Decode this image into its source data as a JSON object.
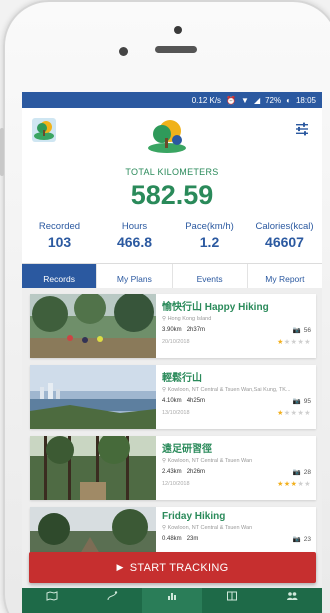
{
  "status_bar": {
    "speed": "0.12 K/s",
    "battery": "72%",
    "time": "18:05"
  },
  "header": {
    "total_label": "TOTAL KILOMETERS",
    "total_value": "582.59"
  },
  "stats": [
    {
      "label": "Recorded",
      "value": "103"
    },
    {
      "label": "Hours",
      "value": "466.8"
    },
    {
      "label": "Pace(km/h)",
      "value": "1.2"
    },
    {
      "label": "Calories(kcal)",
      "value": "46607"
    }
  ],
  "tabs": [
    "Records",
    "My Plans",
    "Events",
    "My Report"
  ],
  "records": [
    {
      "title": "愉快行山 Happy Hiking",
      "location": "Hong Kong Island",
      "distance": "3.90km",
      "duration": "2h37m",
      "photos": "56",
      "date": "20/10/2018",
      "rating": 1
    },
    {
      "title": "輕鬆行山",
      "location": "Kowloon, NT Central & Tsuen Wan,Sai Kung, TK...",
      "distance": "4.10km",
      "duration": "4h25m",
      "photos": "95",
      "date": "13/10/2018",
      "rating": 1
    },
    {
      "title": "遠足研習徑",
      "location": "Kowloon, NT Central & Tsuen Wan",
      "distance": "2.43km",
      "duration": "2h26m",
      "photos": "28",
      "date": "12/10/2018",
      "rating": 3
    },
    {
      "title": "Friday Hiking",
      "location": "Kowloon, NT Central & Tsuen Wan",
      "distance": "0.48km",
      "duration": "23m",
      "photos": "23",
      "date": "",
      "rating": 0
    }
  ],
  "start_button": "START TRACKING",
  "colors": {
    "primary_blue": "#2b59a0",
    "brand_green": "#2a8a5a",
    "start_red": "#c62f2f",
    "nav_green": "#1e6a48"
  },
  "icons": {
    "settings": "sliders-icon",
    "camera": "camera-icon",
    "play": "play-icon"
  }
}
